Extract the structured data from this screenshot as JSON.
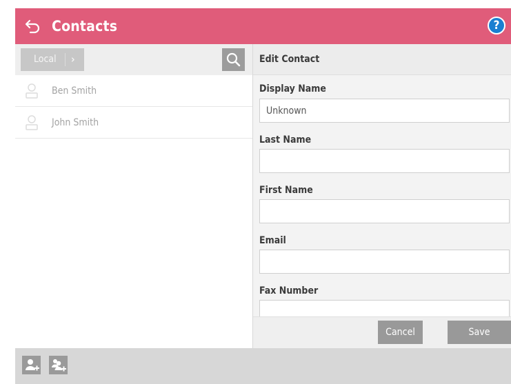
{
  "header": {
    "title": "Contacts",
    "back_icon": "back-arrow-icon",
    "help_icon": "help-icon",
    "help_glyph": "?",
    "color": "#e05c7a"
  },
  "left_panel": {
    "source_button": {
      "label": "Local",
      "chevron": "›"
    },
    "search_icon": "search-icon",
    "contacts": [
      {
        "name": "Ben Smith",
        "icon": "person-icon"
      },
      {
        "name": "John Smith",
        "icon": "person-icon"
      }
    ]
  },
  "edit_panel": {
    "title": "Edit Contact",
    "fields": [
      {
        "label": "Display Name",
        "value": "Unknown",
        "placeholder": ""
      },
      {
        "label": "Last Name",
        "value": "",
        "placeholder": ""
      },
      {
        "label": "First Name",
        "value": "",
        "placeholder": ""
      },
      {
        "label": "Email",
        "value": "",
        "placeholder": ""
      },
      {
        "label": "Fax Number",
        "value": "",
        "placeholder": ""
      }
    ],
    "cancel_label": "Cancel",
    "save_label": "Save"
  },
  "bottom_bar": {
    "add_contact_icon": "add-contact-icon",
    "add_group_icon": "add-group-icon"
  },
  "colors": {
    "accent": "#e05c7a",
    "help": "#1a7fd1",
    "button_gray": "#999999"
  }
}
